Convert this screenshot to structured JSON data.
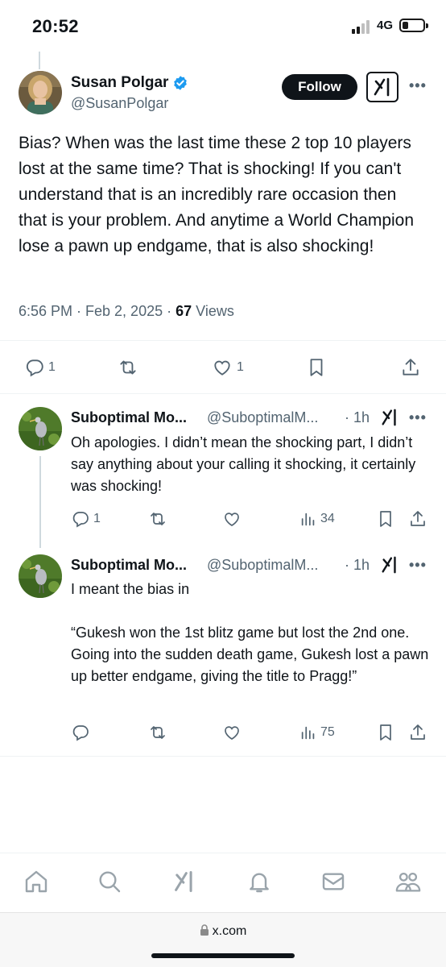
{
  "status_bar": {
    "time": "20:52",
    "network": "4G"
  },
  "main_tweet": {
    "author_name": "Susan Polgar",
    "handle": "@SusanPolgar",
    "follow_label": "Follow",
    "text": "Bias? When was the last time these 2 top 10 players lost at the same time? That is shocking! If you can't understand that is an incredibly rare occasion then that is your problem. And anytime a World Champion lose a pawn up endgame, that is also shocking!",
    "time": "6:56 PM · Feb 2, 2025 · ",
    "views_count": "67",
    "views_label": " Views",
    "replies": "1",
    "likes": "1"
  },
  "replies": [
    {
      "name": "Suboptimal Mo...",
      "handle": "@SuboptimalM...",
      "time": "· 1h",
      "text": "Oh apologies. I didn’t mean the shocking part, I didn’t say anything about your calling it shocking, it certainly was shocking!",
      "reply_count": "1",
      "views": "34"
    },
    {
      "name": "Suboptimal Mo...",
      "handle": "@SuboptimalM...",
      "time": "· 1h",
      "text": "I meant the bias in\n\n“Gukesh won the 1st blitz game but lost the 2nd one. Going into the sudden death game, Gukesh lost a pawn up better endgame, giving the title to Pragg!”",
      "reply_count": "",
      "views": "75"
    }
  ],
  "browser": {
    "url": "x.com"
  },
  "icons": {
    "verified": "verified-badge-icon",
    "reply": "reply-icon",
    "retweet": "retweet-icon",
    "like": "like-icon",
    "bookmark": "bookmark-icon",
    "share": "share-icon",
    "views": "views-icon",
    "home": "home-icon",
    "search": "search-icon",
    "grok": "grok-icon",
    "notifications": "bell-icon",
    "messages": "mail-icon",
    "communities": "people-icon",
    "lock": "lock-icon"
  },
  "colors": {
    "accent": "#1d9bf0",
    "text": "#0f1419",
    "secondary": "#536471"
  }
}
